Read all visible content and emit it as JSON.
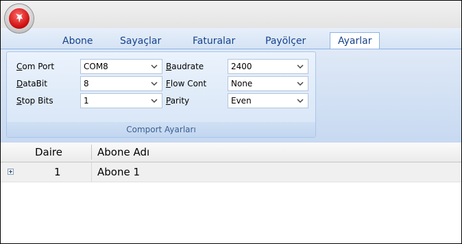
{
  "app": {
    "button_icon": "app-logo-icon"
  },
  "tabs": [
    {
      "label": "Abone"
    },
    {
      "label": "Sayaçlar"
    },
    {
      "label": "Faturalar"
    },
    {
      "label": "Payölçer"
    },
    {
      "label": "Ayarlar",
      "active": true
    }
  ],
  "ribbon": {
    "group_caption": "Comport Ayarları",
    "fields": {
      "com_port": {
        "label_first": "C",
        "label_rest": "om Port",
        "value": "COM8"
      },
      "databit": {
        "label_first": "D",
        "label_rest": "ataBit",
        "value": "8"
      },
      "stop_bits": {
        "label_first": "S",
        "label_rest": "top Bits",
        "value": "1"
      },
      "baudrate": {
        "label_first": "B",
        "label_rest": "audrate",
        "value": "2400"
      },
      "flow_cont": {
        "label_first": "F",
        "label_rest": "low Cont",
        "value": "None"
      },
      "parity": {
        "label_first": "P",
        "label_rest": "arity",
        "value": "Even"
      }
    }
  },
  "grid": {
    "columns": [
      "Daire",
      "Abone Adı"
    ],
    "rows": [
      {
        "daire": "1",
        "abone_adi": "Abone 1"
      }
    ]
  },
  "colors": {
    "accent": "#15428b",
    "ribbon_bg": "#d5e3f5",
    "app_button": "#d01010"
  }
}
